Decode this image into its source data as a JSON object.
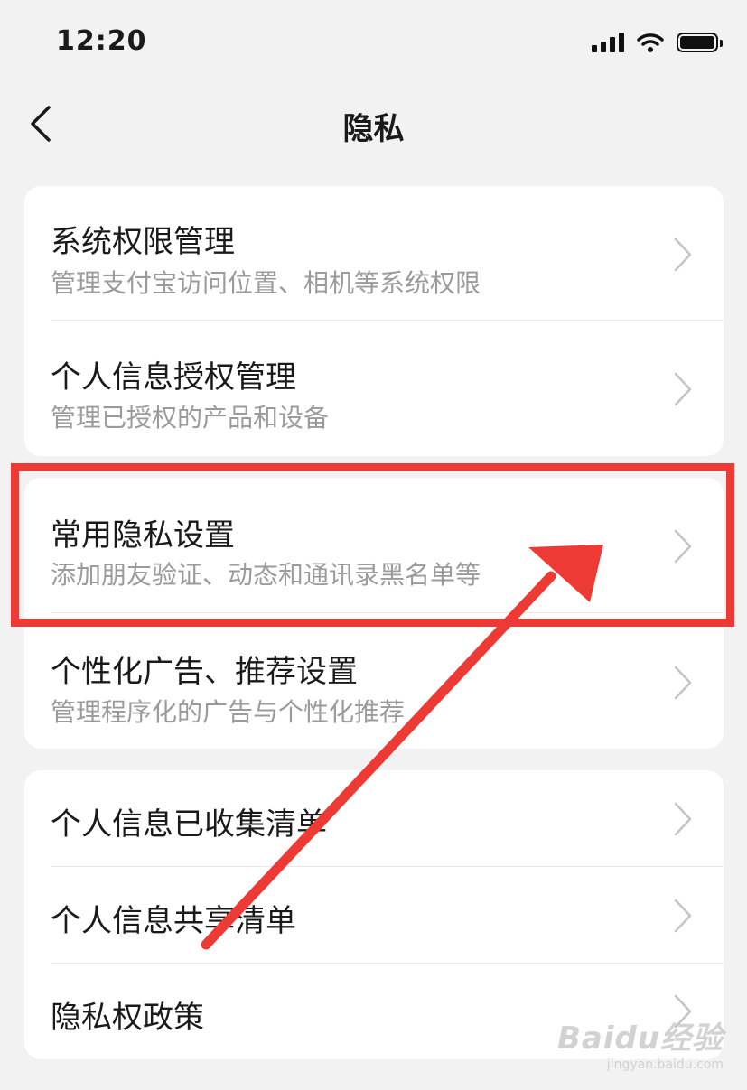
{
  "status_bar": {
    "time": "12:20"
  },
  "nav": {
    "title": "隐私"
  },
  "group1": [
    {
      "title": "系统权限管理",
      "subtitle": "管理支付宝访问位置、相机等系统权限"
    },
    {
      "title": "个人信息授权管理",
      "subtitle": "管理已授权的产品和设备"
    }
  ],
  "group2": [
    {
      "title": "常用隐私设置",
      "subtitle": "添加朋友验证、动态和通讯录黑名单等"
    },
    {
      "title": "个性化广告、推荐设置",
      "subtitle": "管理程序化的广告与个性化推荐"
    }
  ],
  "group3": [
    {
      "title": "个人信息已收集清单"
    },
    {
      "title": "个人信息共享清单"
    },
    {
      "title": "隐私权政策"
    }
  ],
  "annotation": {
    "color": "#ee3a35"
  },
  "watermark": {
    "brand": "Baidu经验",
    "url": "jingyan.baidu.com"
  }
}
